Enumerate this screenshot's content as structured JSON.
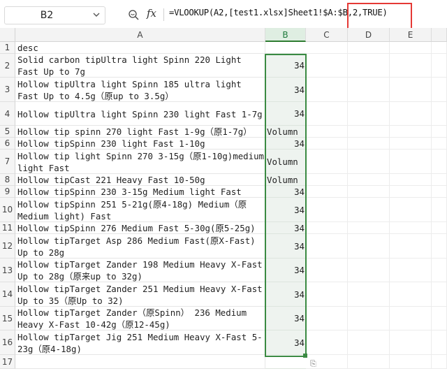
{
  "name_box": "B2",
  "formula": "=VLOOKUP(A2,[test1.xlsx]Sheet1!$A:$B,2,TRUE)",
  "icons": {
    "zoom": "zoom-icon",
    "fx": "fx-icon",
    "dropdown": "chevron-down-icon"
  },
  "fx_label": "fx",
  "columns": [
    "A",
    "B",
    "C",
    "D",
    "E"
  ],
  "selected_column": "B",
  "highlight_color": "#e53935",
  "selection_color": "#3a8a42",
  "rows": [
    {
      "num": "1",
      "a": "desc",
      "b": ""
    },
    {
      "num": "2",
      "a": "Solid carbon tipUltra light Spinn 220 Light Fast Up to 7g",
      "b": "34"
    },
    {
      "num": "3",
      "a": "Hollow tipUltra light Spinn 185  ultra light  Fast Up to 4.5g（原up to 3.5g）",
      "b": "34"
    },
    {
      "num": "4",
      "a": "Hollow tipUltra light Spinn 230  light   Fast 1-7g",
      "b": "34"
    },
    {
      "num": "5",
      "a": "Hollow tip spinn 270  light  Fast 1-9g（原1-7g）",
      "b": "Volumn"
    },
    {
      "num": "6",
      "a": "Hollow tipSpinn 230 light  Fast 1-10g",
      "b": "34"
    },
    {
      "num": "7",
      "a": "Hollow tip light Spinn 270 3-15g（原1-10g)medium light Fast",
      "b": "Volumn"
    },
    {
      "num": "8",
      "a": "Hollow tipCast  221  Heavy  Fast  10-50g",
      "b": "Volumn"
    },
    {
      "num": "9",
      "a": "Hollow tipSpinn 230 3-15g Medium light Fast",
      "b": "34"
    },
    {
      "num": "10",
      "a": "Hollow tipSpinn 251 5-21g(原4-18g) Medium（原Medium light) Fast",
      "b": "34"
    },
    {
      "num": "11",
      "a": "Hollow tipSpinn 276  Medium  Fast 5-30g(原5-25g)",
      "b": "34"
    },
    {
      "num": "12",
      "a": "Hollow tipTarget Asp  286 Medium  Fast(原X-Fast) Up to 28g",
      "b": "34"
    },
    {
      "num": "13",
      "a": "Hollow tipTarget Zander  198 Medium Heavy  X-Fast Up to 28g（原来up to 32g)",
      "b": "34"
    },
    {
      "num": "14",
      "a": "Hollow tipTarget Zander 251 Medium Heavy  X-Fast Up to 35（原Up to 32)",
      "b": "34"
    },
    {
      "num": "15",
      "a": "Hollow tipTarget Zander（原Spinn） 236 Medium Heavy X-Fast 10-42g（原12-45g)",
      "b": "34"
    },
    {
      "num": "16",
      "a": "Hollow tipTarget Jig 251 Medium Heavy   X-Fast 5-23g（原4-18g)",
      "b": "34"
    },
    {
      "num": "17",
      "a": "",
      "b": ""
    }
  ]
}
